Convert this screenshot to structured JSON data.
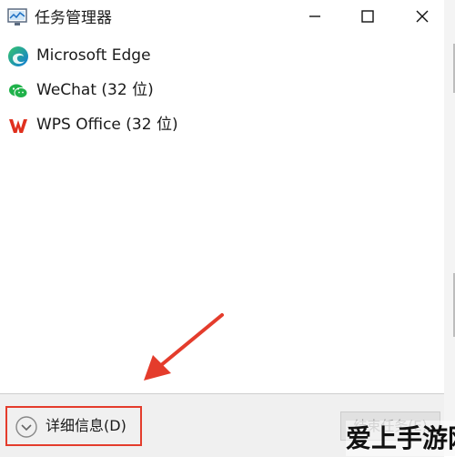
{
  "window": {
    "title": "任务管理器",
    "controls": {
      "minimize_icon": "minimize-icon",
      "maximize_icon": "maximize-icon",
      "close_icon": "close-icon"
    }
  },
  "apps": [
    {
      "label": "Microsoft Edge",
      "icon": "edge-icon"
    },
    {
      "label": "WeChat (32 位)",
      "icon": "wechat-icon"
    },
    {
      "label": "WPS Office (32 位)",
      "icon": "wps-icon"
    }
  ],
  "footer": {
    "details_label": "详细信息(D)",
    "details_icon": "chevron-down-circle-icon",
    "end_task_label": "结束任务(E)"
  },
  "annotation": {
    "highlight_color": "#e43c2c",
    "arrow_color": "#e43c2c"
  },
  "watermark": {
    "text": "爱上手游网"
  },
  "colors": {
    "edge_blue": "#0f7ad8",
    "edge_green": "#36c46b",
    "wechat_green": "#1fb24a",
    "wps_red": "#e0301e"
  }
}
